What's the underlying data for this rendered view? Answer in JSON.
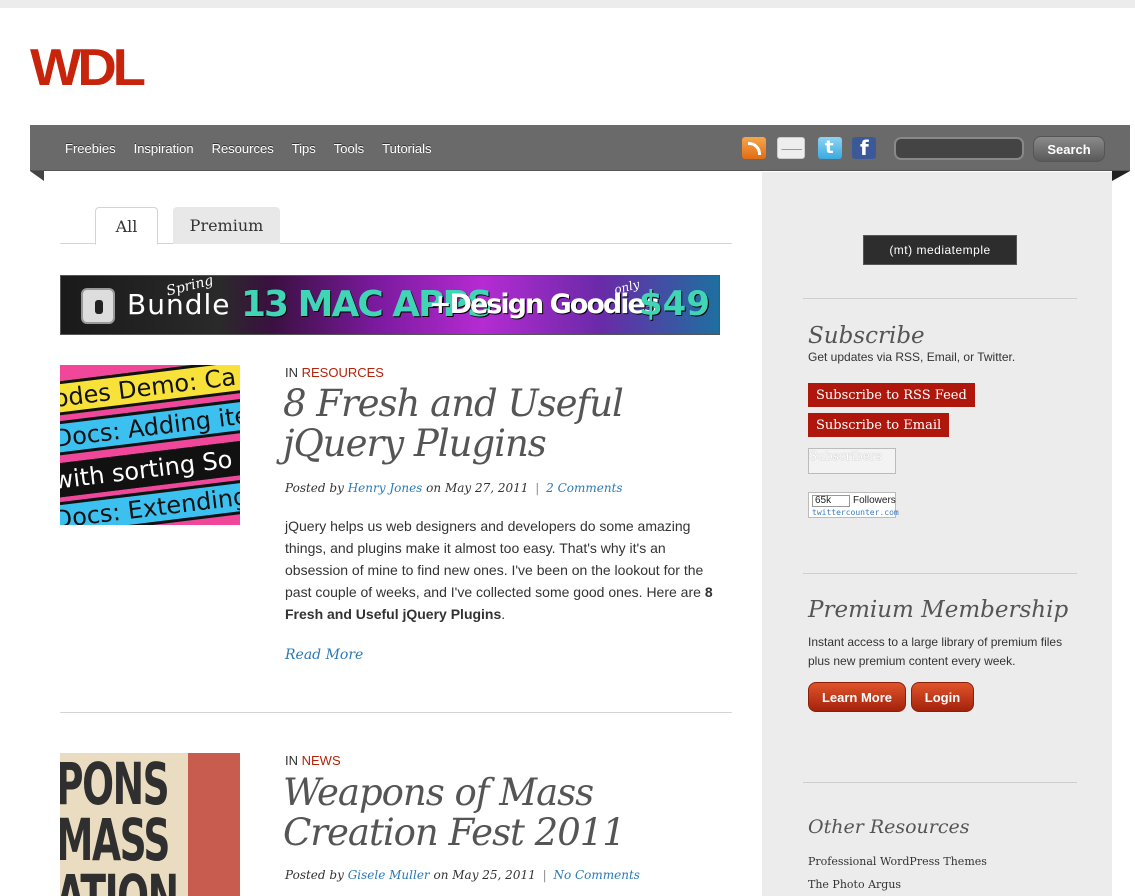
{
  "brand": {
    "logo_text": "WDL",
    "accent": "#c8240b"
  },
  "nav": {
    "items": [
      "Freebies",
      "Inspiration",
      "Resources",
      "Tips",
      "Tools",
      "Tutorials"
    ],
    "social_icons": [
      "rss-icon",
      "email-icon",
      "twitter-icon",
      "facebook-icon"
    ],
    "search_placeholder": "",
    "search_button": "Search"
  },
  "tabs": {
    "all": "All",
    "premium": "Premium"
  },
  "banner": {
    "spring": "Spring",
    "bundle": "Bundle",
    "apps": "13 MAC APPS",
    "goodies": "+Design Goodies",
    "only": "only",
    "price": "$49"
  },
  "posts": [
    {
      "in_label": "IN",
      "category": "RESOURCES",
      "title_line1": "8 Fresh and Useful",
      "title_line2": "jQuery Plugins",
      "posted_by": "Posted by",
      "author": "Henry Jones",
      "date": "on May 27, 2011",
      "separator": "|",
      "comments": "2 Comments",
      "excerpt_text": "jQuery helps us web designers and developers do some amazing things, and plugins make it almost too easy. That's why it's an obsession of mine to find new ones. I've been on the lookout for the past couple of weeks, and I've collected some good ones. Here are ",
      "excerpt_bold": "8 Fresh and Useful jQuery Plugins",
      "excerpt_end": ".",
      "read_more": "Read More",
      "thumb_lines": [
        "odes  Demo: Ca",
        "Docs: Adding ite",
        "with sorting  So",
        "Docs: Extending"
      ]
    },
    {
      "in_label": "IN",
      "category": "NEWS",
      "title_line1": "Weapons of Mass",
      "title_line2": "Creation Fest 2011",
      "posted_by": "Posted by",
      "author": "Gisele Muller",
      "date": "on May 25, 2011",
      "separator": "|",
      "comments": "No Comments",
      "thumb_lines": [
        "PONS",
        "MASS",
        "ATION"
      ]
    }
  ],
  "sidebar": {
    "sponsor": "(mt) mediatemple",
    "subscribe": {
      "heading": "Subscribe",
      "text": "Get updates via RSS, Email, or Twitter.",
      "rss_button": "Subscribe to RSS Feed",
      "email_button": "Subscribe to Email",
      "subscribers_label": "Subscribers",
      "twitter_count": "65k",
      "followers_label": "Followers",
      "twittercounter_url": "twittercounter.com"
    },
    "premium": {
      "heading": "Premium Membership",
      "text_line1": "Instant access to a large library of premium files",
      "text_line2": "plus new premium content every week.",
      "learn_more": "Learn More",
      "login": "Login"
    },
    "other": {
      "heading": "Other Resources",
      "links": [
        "Professional WordPress Themes",
        "The Photo Argus"
      ]
    }
  }
}
